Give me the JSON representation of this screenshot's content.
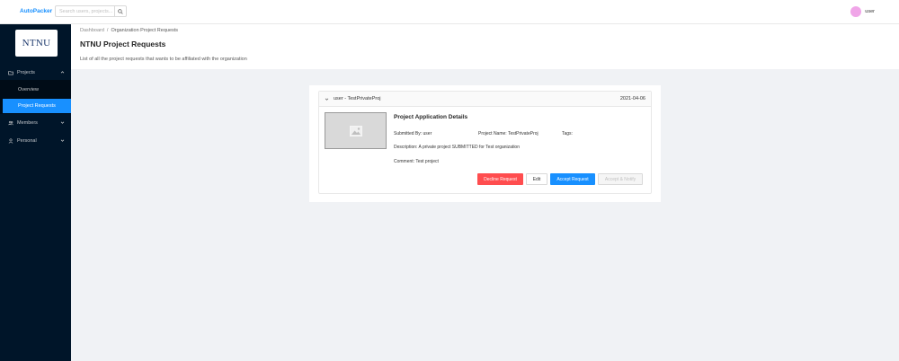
{
  "header": {
    "brand": "AutoPacker",
    "search_placeholder": "Search users, projects...",
    "user_name": "user"
  },
  "sidebar": {
    "logo_text": "NTNU",
    "items": [
      {
        "label": "Projects",
        "icon": "folder-icon"
      },
      {
        "label": "Members",
        "icon": "team-icon"
      },
      {
        "label": "Personal",
        "icon": "user-icon"
      }
    ],
    "sub_items": [
      {
        "label": "Overview"
      },
      {
        "label": "Project Requests"
      }
    ]
  },
  "page": {
    "breadcrumb": [
      "Dashboard",
      "Organization Project Requests"
    ],
    "title": "NTNU Project Requests",
    "description": "List of all the project requests that wants to be affiliated with the organization"
  },
  "request": {
    "header_title": "user - TestPrivateProj",
    "date": "2021-04-06",
    "details_title": "Project Application Details",
    "submitted_by_label": "Submitted By:",
    "submitted_by": "user",
    "project_name_label": "Project Name:",
    "project_name": "TestPrivateProj",
    "tags_label": "Tags:",
    "description_label": "Description:",
    "description": "A private project SUBMITTED for Test organization",
    "comment_label": "Comment:",
    "comment": "Test project",
    "buttons": {
      "decline": "Decline Request",
      "edit": "Edit",
      "accept": "Accept Request",
      "accept_notify": "Accept & Notify"
    }
  },
  "colors": {
    "primary": "#1890ff",
    "danger": "#ff4d4f",
    "sidebar": "#001529",
    "avatar": "#f0a5e8"
  }
}
